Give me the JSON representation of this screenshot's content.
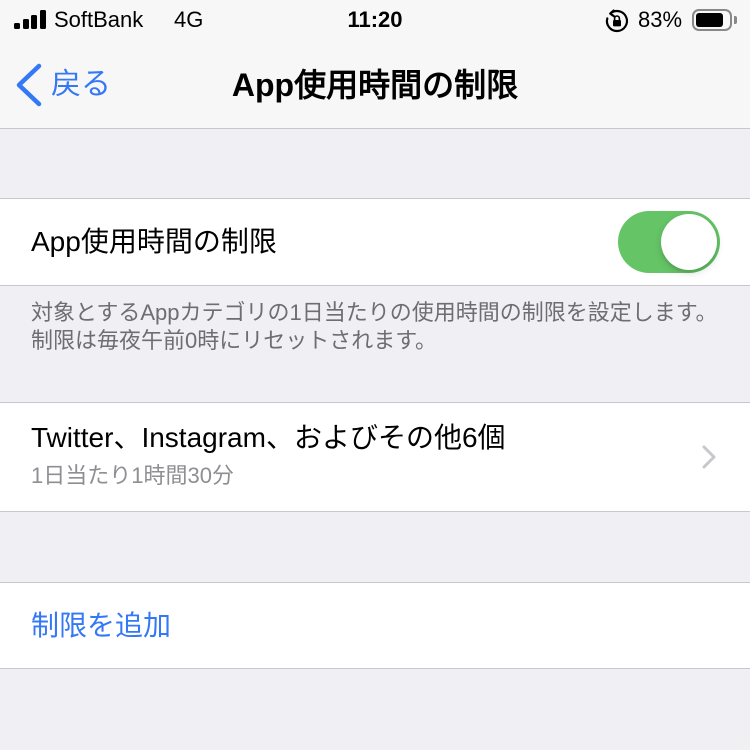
{
  "status_bar": {
    "carrier": "SoftBank",
    "network": "4G",
    "time": "11:20",
    "battery_text": "83%",
    "battery_level": 0.83,
    "signal_bars": 4
  },
  "nav_bar": {
    "back_label": "戻る",
    "title": "App使用時間の制限"
  },
  "sections": {
    "toggle": {
      "label": "App使用時間の制限",
      "on": true,
      "footer": "対象とするAppカテゴリの1日当たりの使用時間の制限を設定します。制限は毎夜午前0時にリセットされます。"
    },
    "limit": {
      "title": "Twitter、Instagram、およびその他6個",
      "subtitle": "1日当たり1時間30分"
    },
    "add": {
      "label": "制限を追加"
    }
  },
  "icons": {
    "signal": "signal-icon",
    "rotation_lock": "rotation-lock-icon",
    "battery": "battery-icon",
    "back": "chevron-left-icon",
    "disclosure": "chevron-right-icon"
  },
  "colors": {
    "accent": "#3478f6",
    "toggle_on": "#65c466",
    "grouped_background": "#efeff4",
    "bar_background": "#f7f7f7",
    "cell_background": "#ffffff",
    "separator": "#c8c7cc",
    "secondary_text": "#8e8e93",
    "footer_text": "#6d6d72",
    "chevron": "#c7c7cc"
  }
}
